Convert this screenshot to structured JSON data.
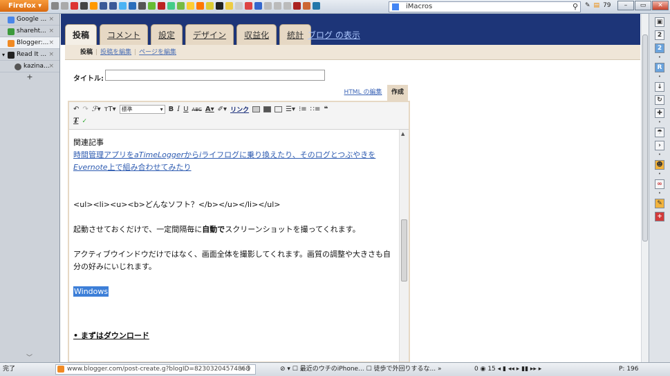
{
  "browser": {
    "firefox_label": "Firefox",
    "search_engine": "iMacros",
    "toolbar_count": "79"
  },
  "sidebar": {
    "tabs": [
      {
        "label": "Google ...",
        "color": "#4a86e8"
      },
      {
        "label": "shareht...",
        "color": "#3c9a3c"
      },
      {
        "label": "Blogger:...",
        "color": "#f08a24"
      },
      {
        "label": "Read It ...",
        "color": "#222222"
      },
      {
        "label": "kazina...",
        "color": "#555555"
      }
    ],
    "add": "+"
  },
  "blogger": {
    "tabs": [
      "投稿",
      "コメント",
      "設定",
      "デザイン",
      "収益化",
      "統計"
    ],
    "view_blog": "ブログ の表示",
    "subtabs": [
      "投稿",
      "投稿を編集",
      "ページを編集"
    ],
    "title_label": "タイトル:",
    "mode_html": "HTML の編集",
    "mode_compose": "作成",
    "font_select": "標準",
    "link_label": "リンク"
  },
  "post": {
    "related_heading": "関連記事",
    "related_link_1": "時間管理アプリを",
    "related_link_italic_1": "aTimeLogger",
    "related_link_2": "から",
    "related_link_italic_2": "i",
    "related_link_3": "ライフログに乗り換えたり、そのログとつぶやきを",
    "related_link_italic_3": "Evernote",
    "related_link_4": "上で組み合わせてみたり",
    "html_line": "<ul><li><u><b>どんなソフト？</b></u></li></ul>",
    "para1_a": "起動させておくだけで、一定間隔毎に",
    "para1_bold": "自動で",
    "para1_b": "スクリーンショットを撮ってくれます。",
    "para2": "アクティブウインドウだけではなく、画面全体を撮影してくれます。画質の調整や大きさも自分の好みにいじれます。",
    "selected": "Windows",
    "bullet": "まずはダウンロード"
  },
  "status": {
    "done": "完了",
    "url": "www.blogger.com/post-create.g?blogID=82303204574868",
    "feed1": "最近のウチのiPhone...",
    "feed2": "徒歩で外回りするな...",
    "left_count": "0",
    "mail_count": "15",
    "pcount": "P: 196"
  }
}
